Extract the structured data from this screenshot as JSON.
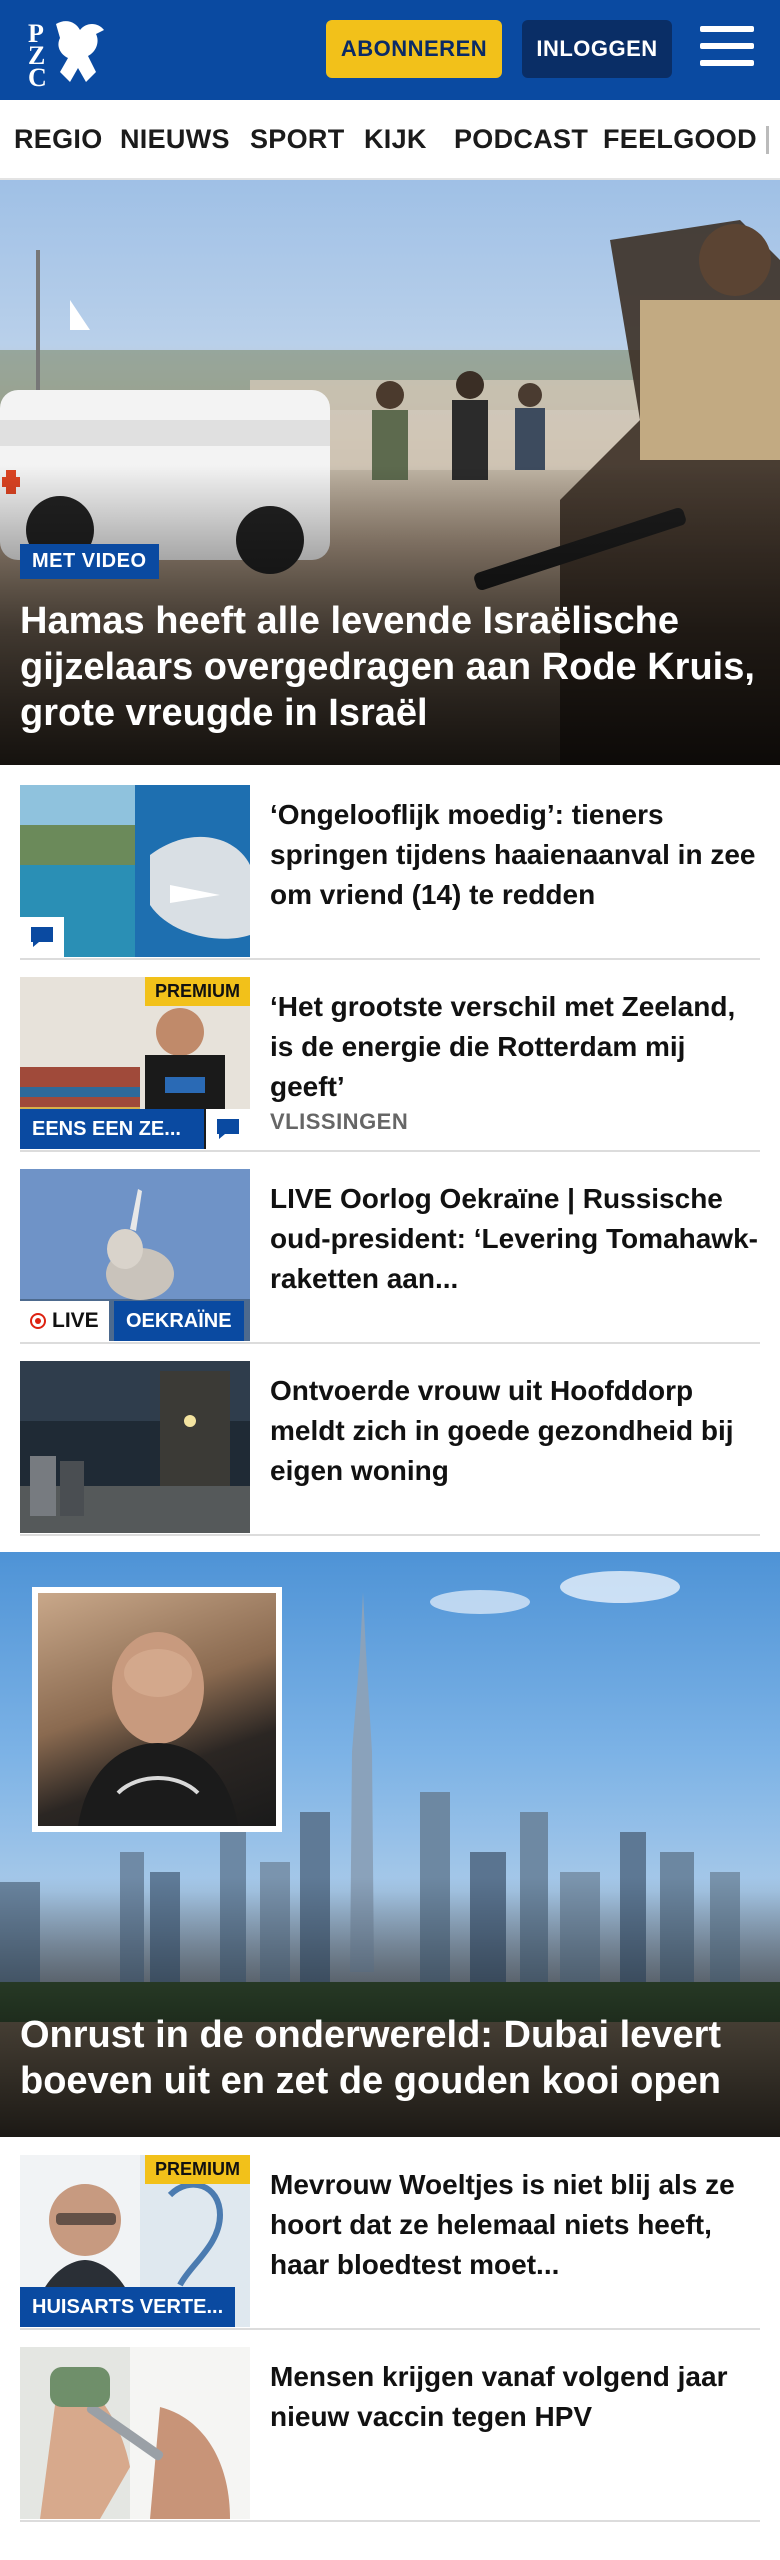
{
  "header": {
    "logo_letters": "PZC",
    "subscribe_label": "ABONNEREN",
    "login_label": "INLOGGEN"
  },
  "nav": {
    "items": [
      "REGIO",
      "NIEUWS",
      "SPORT",
      "KIJK",
      "PODCAST",
      "FEELGOOD"
    ]
  },
  "hero": {
    "tag": "MET VIDEO",
    "title": "Hamas heeft alle levende Israëlische gijzelaars overgedragen aan Rode Kruis, grote vreugde in Israël"
  },
  "articles": [
    {
      "title": "‘Ongelooflijk moedig’: tieners springen tijdens haaienaanval in zee om vriend (14) te redden"
    },
    {
      "title": "‘Het grootste verschil met Zeeland, is de energie die Rotterdam mij geeft’",
      "premium": "PREMIUM",
      "category": "EENS EEN ZE...",
      "location": "VLISSINGEN"
    },
    {
      "title": "LIVE Oorlog Oekraïne | Russische oud-president: ‘Levering Tomahawk-raketten aan...",
      "live": "LIVE",
      "category": "OEKRAÏNE"
    },
    {
      "title": "Ontvoerde vrouw uit Hoofddorp meldt zich in goede gezondheid bij eigen woning"
    }
  ],
  "hero2": {
    "title": "Onrust in de onderwereld: Dubai levert boeven uit en zet de gouden kooi open"
  },
  "articles2": [
    {
      "title": "Mevrouw Woeltjes is niet blij als ze hoort dat ze helemaal niets heeft, haar bloedtest moet...",
      "premium": "PREMIUM",
      "category": "HUISARTS VERTE..."
    },
    {
      "title": "Mensen krijgen vanaf volgend jaar nieuw vaccin tegen HPV"
    }
  ],
  "colors": {
    "brand_blue": "#0a4aa1",
    "accent_yellow": "#f2c11a",
    "dark_blue": "#0a2e66"
  }
}
